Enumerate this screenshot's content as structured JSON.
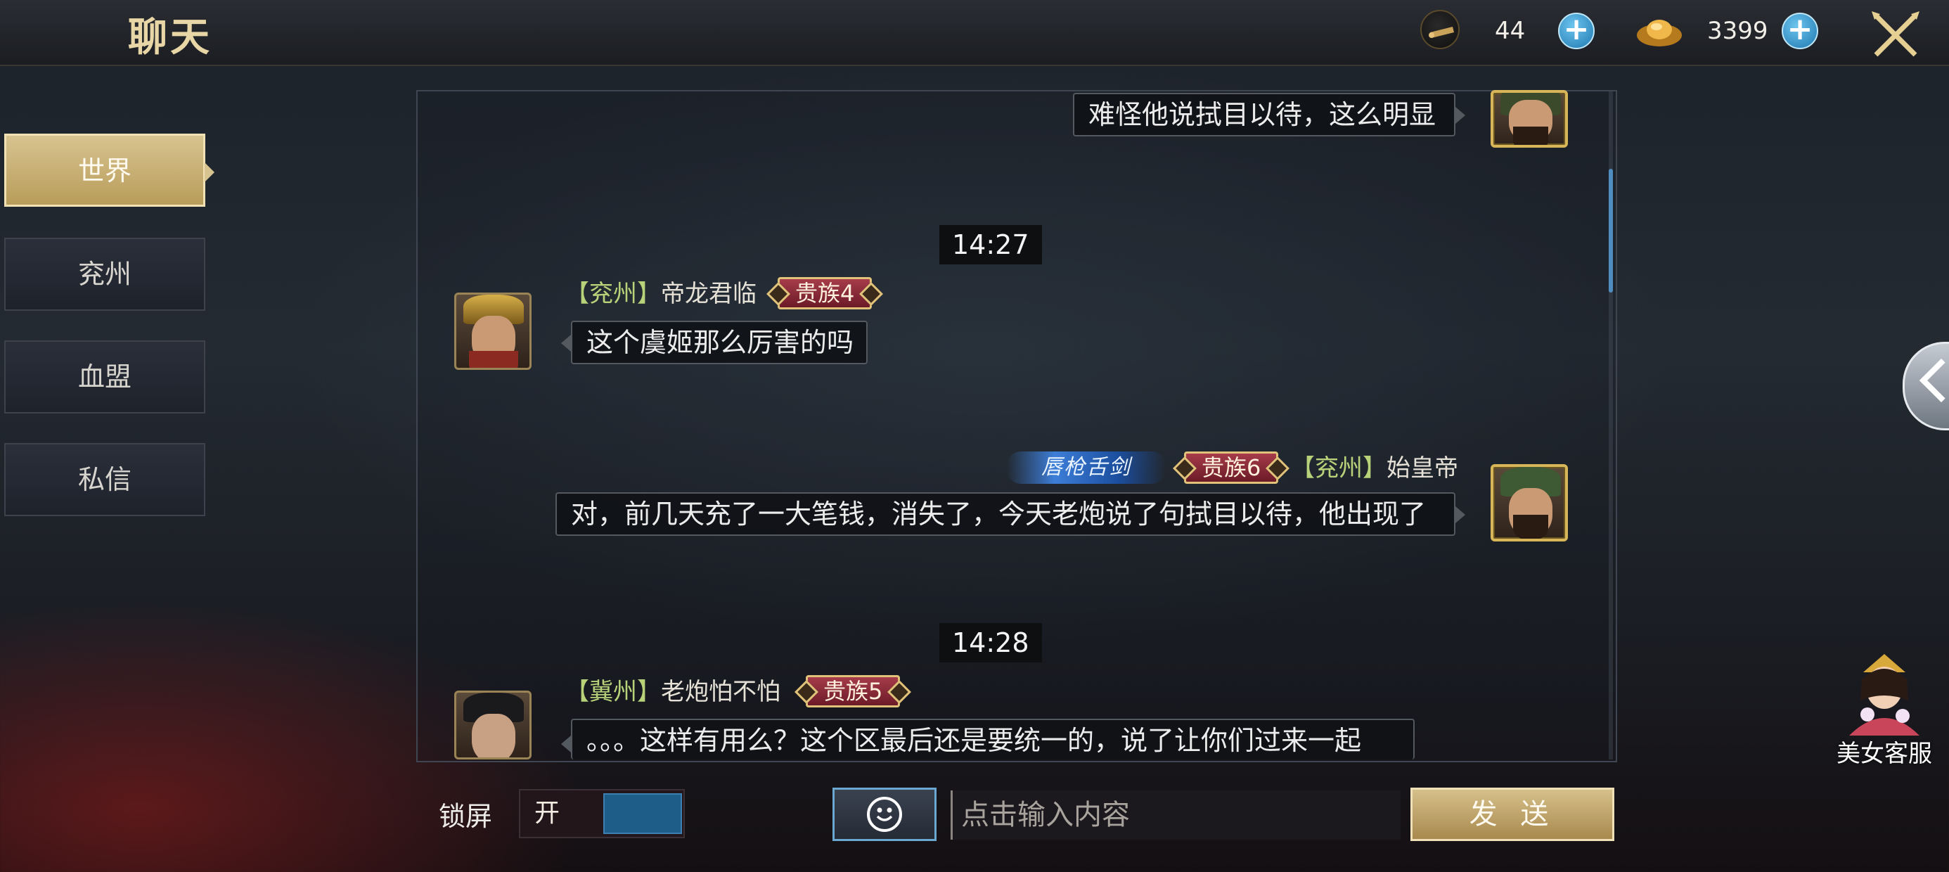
{
  "header": {
    "title": "聊天",
    "resources": [
      {
        "icon": "scroll-token-icon",
        "value": "44"
      },
      {
        "icon": "gold-ingot-icon",
        "value": "3399"
      }
    ]
  },
  "tabs": [
    {
      "label": "世界",
      "active": true
    },
    {
      "label": "兖州",
      "active": false
    },
    {
      "label": "血盟",
      "active": false
    },
    {
      "label": "私信",
      "active": false
    }
  ],
  "messages": [
    {
      "type": "text",
      "side": "right",
      "text": "难怪他说拭目以待，这么明显"
    },
    {
      "type": "time",
      "text": "14:27"
    },
    {
      "type": "text",
      "side": "left",
      "region": "【兖州】",
      "name": "帝龙君临",
      "rank": "贵族4",
      "text": "这个虞姬那么厉害的吗"
    },
    {
      "type": "text",
      "side": "right",
      "title": "唇枪舌剑",
      "rank": "贵族6",
      "region": "【兖州】",
      "name": "始皇帝",
      "text": "对，前几天充了一大笔钱，消失了，今天老炮说了句拭目以待，他出现了"
    },
    {
      "type": "time",
      "text": "14:28"
    },
    {
      "type": "text",
      "side": "left",
      "region": "【冀州】",
      "name": "老炮怕不怕",
      "rank": "贵族5",
      "text": "。。。这样有用么？这个区最后还是要统一的，说了让你们过来一起"
    }
  ],
  "footer": {
    "lock_label": "锁屏",
    "toggle_label": "开",
    "input_placeholder": "点击输入内容",
    "send_label": "发 送"
  },
  "service": {
    "label": "美女客服"
  },
  "colors": {
    "accent_gold": "#d6c08a",
    "region_green": "#b8d27a",
    "rank_red": "#a63c4a",
    "scroll_blue": "#4f8cc0"
  }
}
